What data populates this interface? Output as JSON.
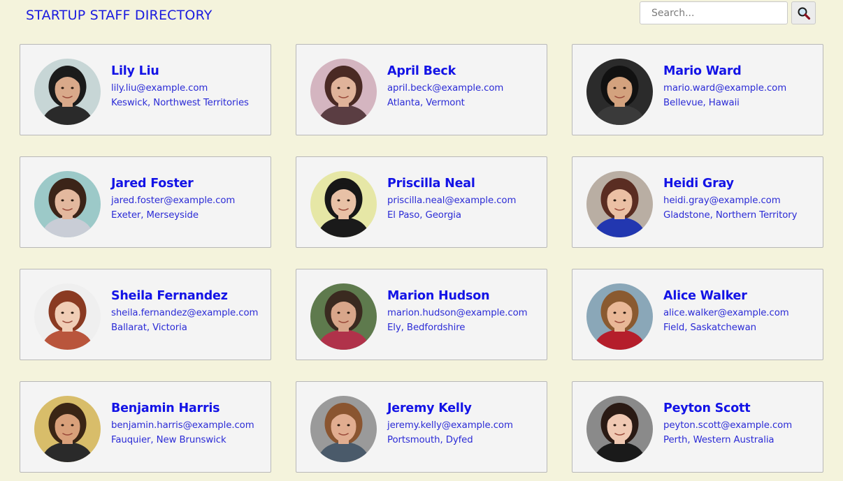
{
  "header": {
    "title": "STARTUP STAFF DIRECTORY",
    "search_placeholder": "Search...",
    "search_icon": "magnifier-icon"
  },
  "colors": {
    "background": "#f4f3dc",
    "card_background": "#f4f4f4",
    "text_accent": "#1313e6"
  },
  "employees": [
    {
      "name": "Lily Liu",
      "email": "lily.liu@example.com",
      "location": "Keswick, Northwest Territories",
      "skin": "#d9a98a",
      "hair": "#1b1b1b",
      "bg": "#c7d6d6",
      "shirt": "#2a2a2a"
    },
    {
      "name": "April Beck",
      "email": "april.beck@example.com",
      "location": "Atlanta, Vermont",
      "skin": "#e0b39a",
      "hair": "#4a2a24",
      "bg": "#d4b5c0",
      "shirt": "#5a3d42"
    },
    {
      "name": "Mario Ward",
      "email": "mario.ward@example.com",
      "location": "Bellevue, Hawaii",
      "skin": "#d3a27e",
      "hair": "#111111",
      "bg": "#2b2b2b",
      "shirt": "#3a3a3a"
    },
    {
      "name": "Jared Foster",
      "email": "jared.foster@example.com",
      "location": "Exeter, Merseyside",
      "skin": "#e3b89e",
      "hair": "#3b2418",
      "bg": "#9cc9c8",
      "shirt": "#c9cdd6"
    },
    {
      "name": "Priscilla Neal",
      "email": "priscilla.neal@example.com",
      "location": "El Paso, Georgia",
      "skin": "#e8c1a6",
      "hair": "#171717",
      "bg": "#e6e7a6",
      "shirt": "#1a1a1a"
    },
    {
      "name": "Heidi Gray",
      "email": "heidi.gray@example.com",
      "location": "Gladstone, Northern Territory",
      "skin": "#ebc0a4",
      "hair": "#5a2d22",
      "bg": "#b9aea3",
      "shirt": "#2237b0"
    },
    {
      "name": "Sheila Fernandez",
      "email": "sheila.fernandez@example.com",
      "location": "Ballarat, Victoria",
      "skin": "#f0cdb6",
      "hair": "#8a3a22",
      "bg": "#efefef",
      "shirt": "#b9553c"
    },
    {
      "name": "Marion Hudson",
      "email": "marion.hudson@example.com",
      "location": "Ely, Bedfordshire",
      "skin": "#d8a68a",
      "hair": "#3a2a20",
      "bg": "#5e7a4d",
      "shirt": "#b0324a"
    },
    {
      "name": "Alice Walker",
      "email": "alice.walker@example.com",
      "location": "Field, Saskatchewan",
      "skin": "#e9b897",
      "hair": "#8a5a30",
      "bg": "#8aa7b8",
      "shirt": "#b51e2b"
    },
    {
      "name": "Benjamin Harris",
      "email": "benjamin.harris@example.com",
      "location": "Fauquier, New Brunswick",
      "skin": "#d9a07a",
      "hair": "#3a2515",
      "bg": "#d8bd6a",
      "shirt": "#2a2a2a"
    },
    {
      "name": "Jeremy Kelly",
      "email": "jeremy.kelly@example.com",
      "location": "Portsmouth, Dyfed",
      "skin": "#e1ad90",
      "hair": "#8a5530",
      "bg": "#9a9a9a",
      "shirt": "#4a5a6a"
    },
    {
      "name": "Peyton Scott",
      "email": "peyton.scott@example.com",
      "location": "Perth, Western Australia",
      "skin": "#f0c9b3",
      "hair": "#2a1a14",
      "bg": "#8a8a8a",
      "shirt": "#1a1a1a"
    }
  ]
}
